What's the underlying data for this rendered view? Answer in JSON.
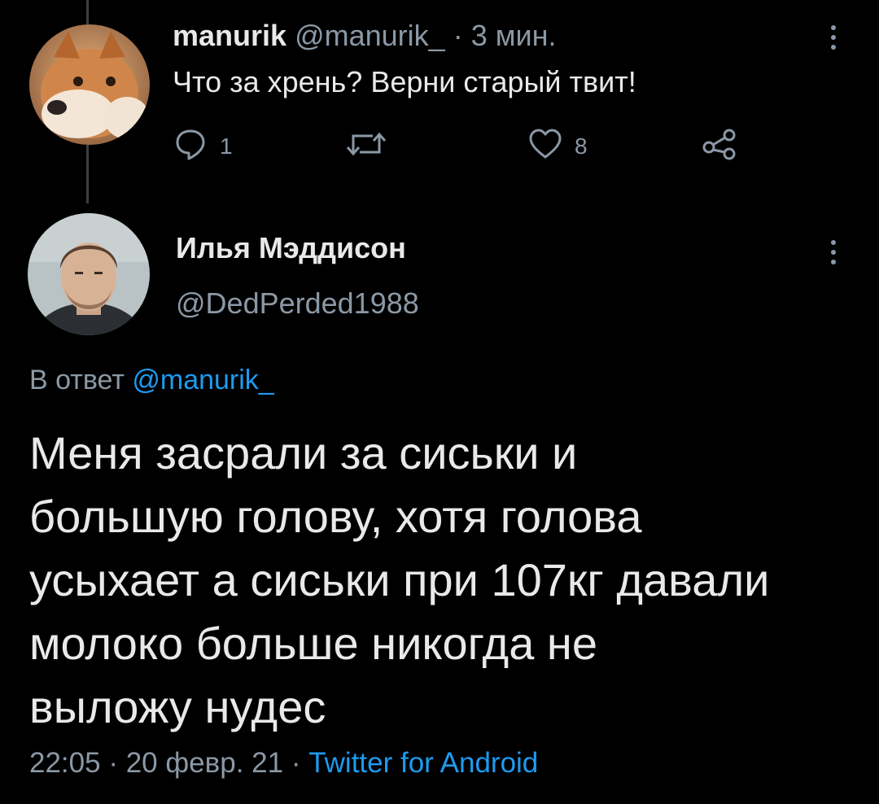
{
  "reply_tweet": {
    "display_name": "manurik",
    "handle": "@manurik_",
    "separator": "·",
    "time": "3 мин.",
    "text": "Что за хрень? Верни старый твит!",
    "actions": {
      "reply_count": "1",
      "retweet_count": "",
      "like_count": "8"
    }
  },
  "main_tweet": {
    "display_name": "Илья Мэддисон",
    "handle": "@DedPerded1988",
    "replying_prefix": "В ответ",
    "replying_to": "@manurik_",
    "text_lines": [
      "Меня засрали за сиськи и",
      "большую голову, хотя голова",
      "усыхает а сиськи при 107кг давали",
      "молоко  больше никогда не",
      "выложу нудес"
    ],
    "time": "22:05",
    "separator": "·",
    "date": "20 февр. 21",
    "source": "Twitter for Android"
  },
  "icons": {
    "reply": "reply-icon",
    "retweet": "retweet-icon",
    "like": "heart-icon",
    "share": "share-icon",
    "more": "more-vertical-icon"
  },
  "colors": {
    "background": "#000000",
    "text": "#e7e9ea",
    "secondary": "#8b98a5",
    "accent": "#1d9bf0"
  }
}
